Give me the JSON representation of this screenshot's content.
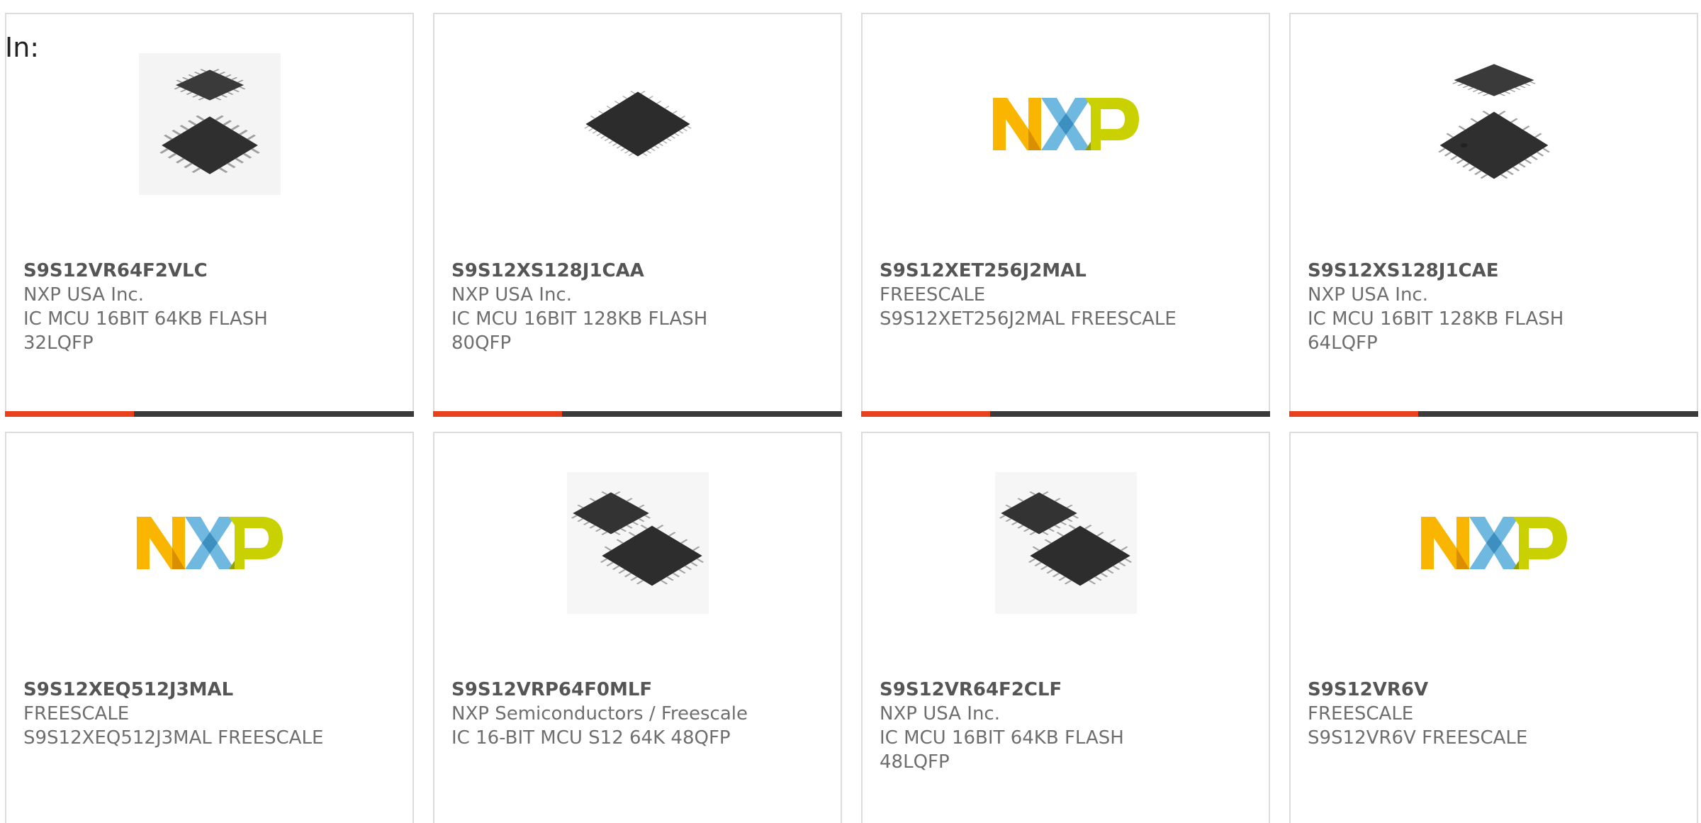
{
  "page": {
    "in_label": "In:"
  },
  "colors": {
    "accent": "#e8401c",
    "bar_dark": "#3b3b3b",
    "card_border": "#dcdcdc",
    "text_bold": "#555555",
    "text": "#6e6e6e",
    "nxp_orange": "#f9b500",
    "nxp_blue": "#6fb8e0",
    "nxp_green": "#c9d200"
  },
  "products": [
    {
      "part": "S9S12VR64F2VLC",
      "maker": "NXP USA Inc.",
      "desc1": "IC MCU 16BIT 64KB FLASH",
      "desc2": "32LQFP",
      "image": "chip-lqfp-32-pair-icon"
    },
    {
      "part": "S9S12XS128J1CAA",
      "maker": "NXP USA Inc.",
      "desc1": "IC MCU 16BIT 128KB FLASH",
      "desc2": "80QFP",
      "image": "chip-qfp-80-icon"
    },
    {
      "part": "S9S12XET256J2MAL",
      "maker": "FREESCALE",
      "desc1": "S9S12XET256J2MAL FREESCALE",
      "desc2": "",
      "image": "nxp-logo"
    },
    {
      "part": "S9S12XS128J1CAE",
      "maker": "NXP USA Inc.",
      "desc1": "IC MCU 16BIT 128KB FLASH",
      "desc2": "64LQFP",
      "image": "chip-lqfp-64-pair-icon"
    },
    {
      "part": "S9S12XEQ512J3MAL",
      "maker": "FREESCALE",
      "desc1": "S9S12XEQ512J3MAL FREESCALE",
      "desc2": "",
      "image": "nxp-logo"
    },
    {
      "part": "S9S12VRP64F0MLF",
      "maker": "NXP Semiconductors / Freescale",
      "desc1": "IC 16-BIT MCU S12 64K 48QFP",
      "desc2": "",
      "image": "chip-lqfp-48-pair-icon"
    },
    {
      "part": "S9S12VR64F2CLF",
      "maker": "NXP USA Inc.",
      "desc1": "IC MCU 16BIT 64KB FLASH",
      "desc2": "48LQFP",
      "image": "chip-lqfp-48-pair-icon"
    },
    {
      "part": "S9S12VR6V",
      "maker": "FREESCALE",
      "desc1": "S9S12VR6V FREESCALE",
      "desc2": "",
      "image": "nxp-logo"
    }
  ]
}
